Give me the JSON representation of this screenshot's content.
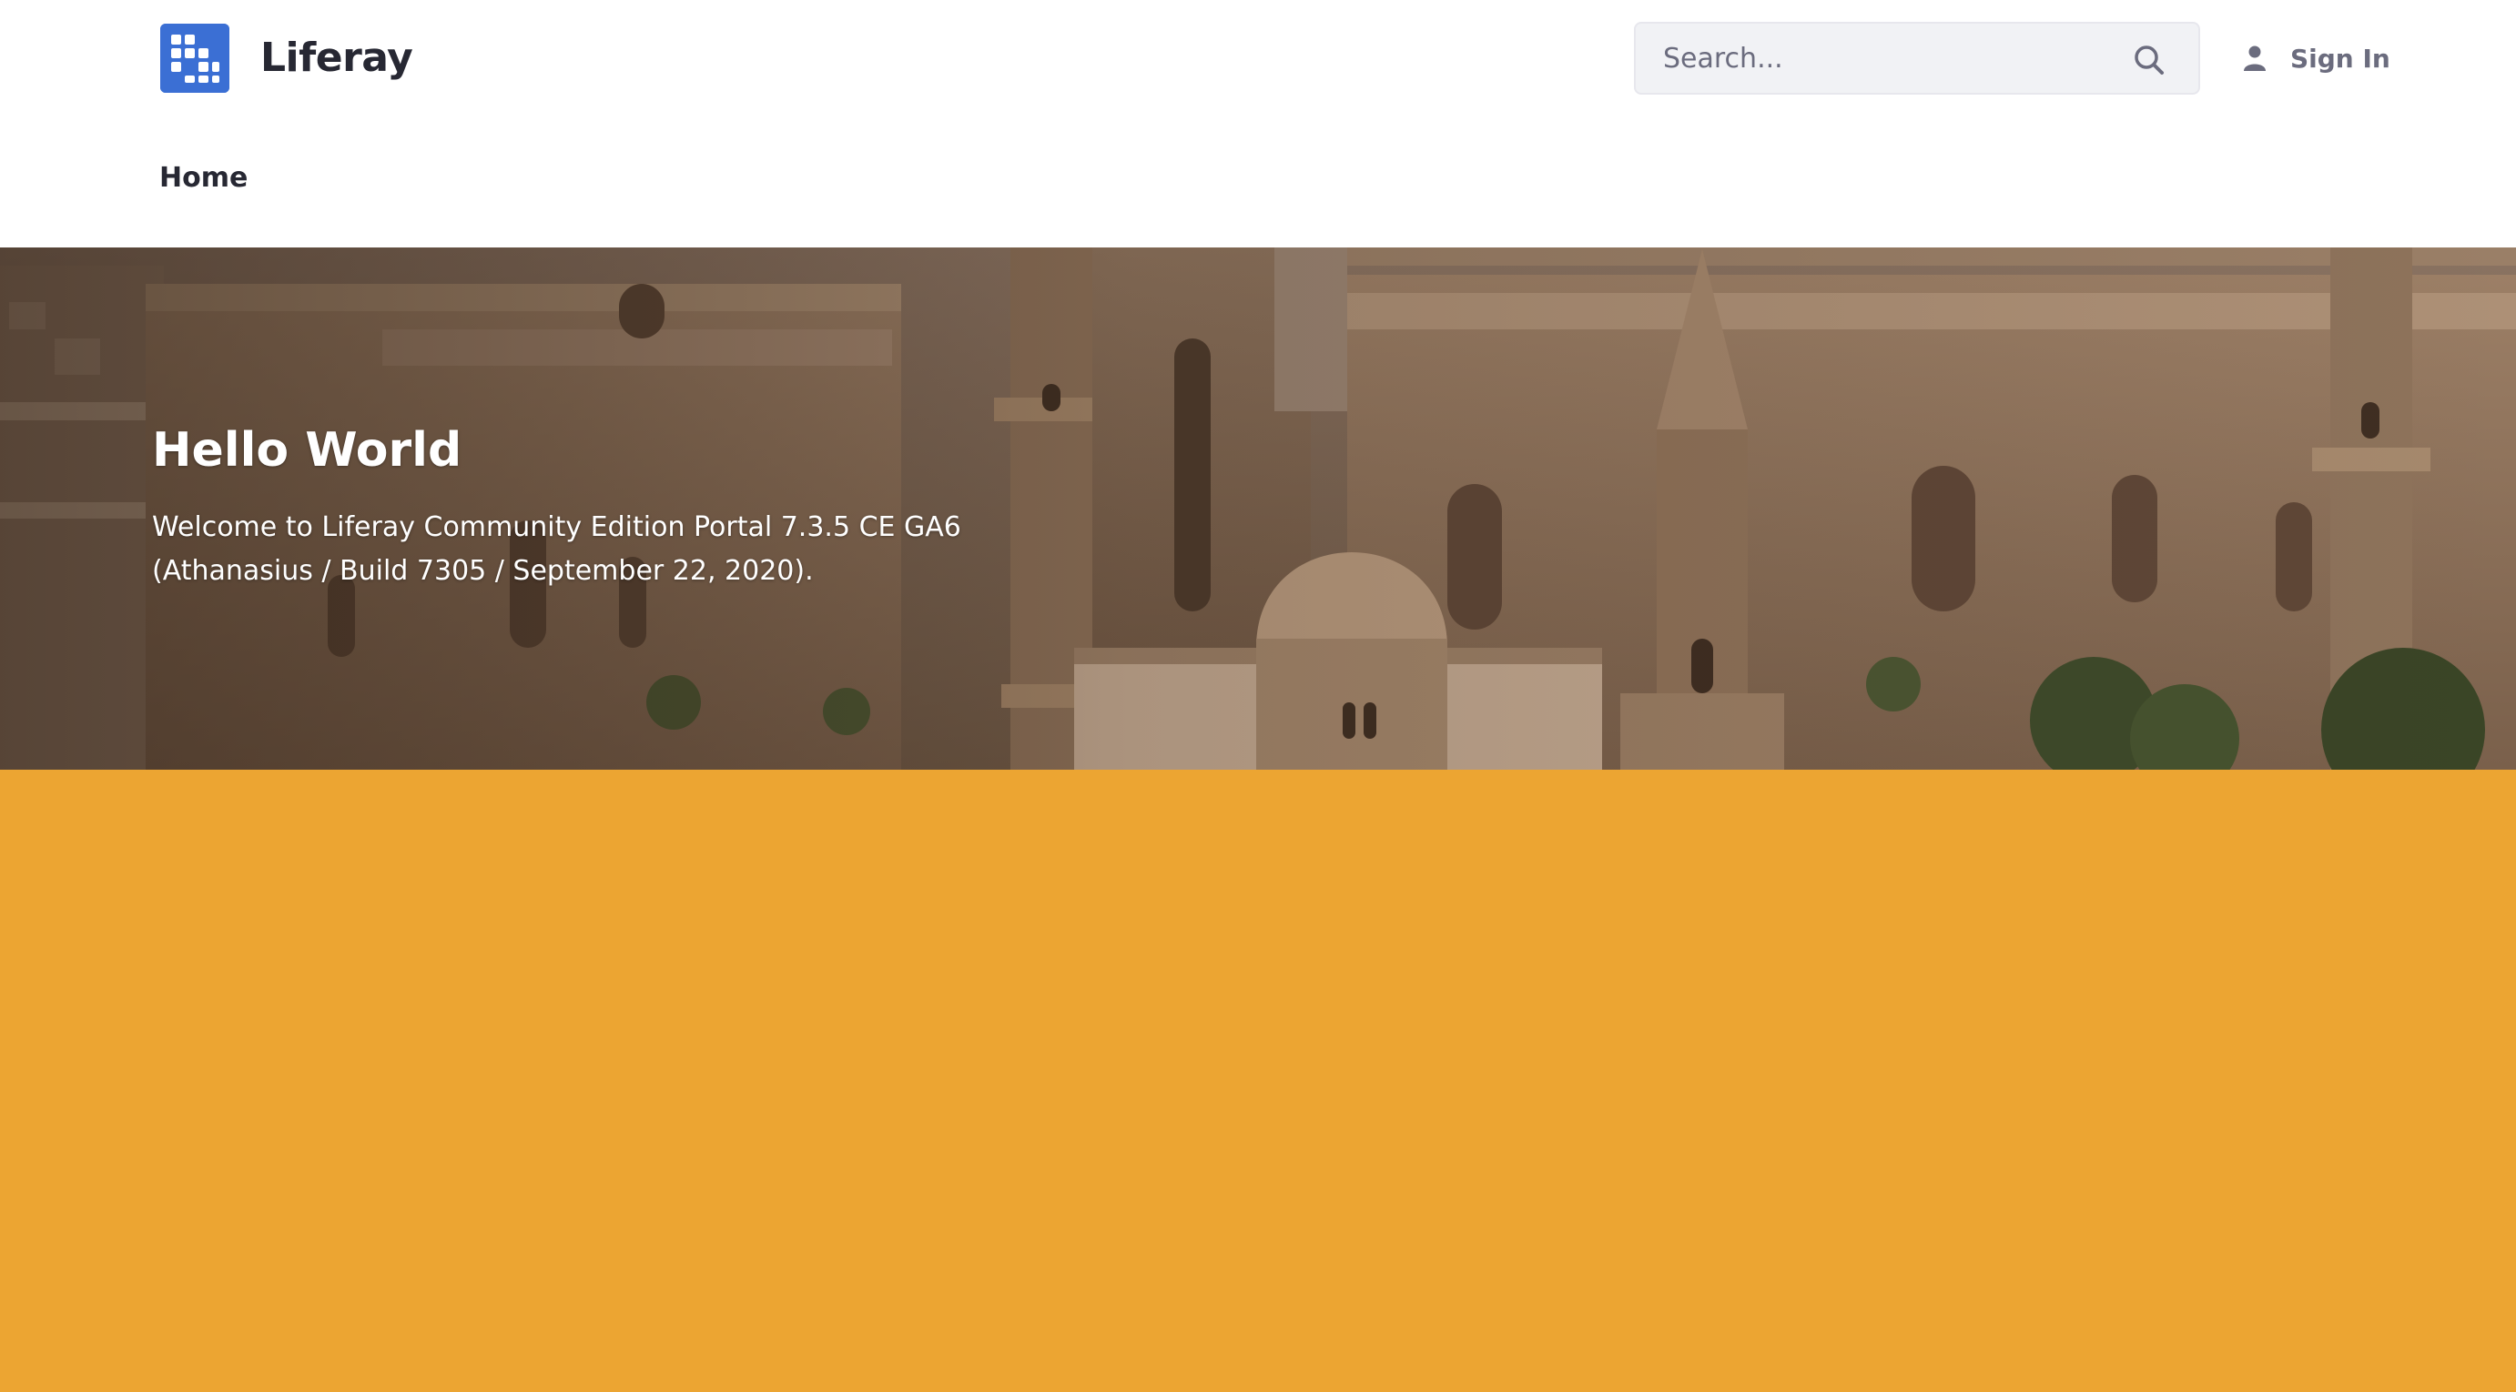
{
  "header": {
    "site_name": "Liferay",
    "logo_icon": "liferay-logo-icon",
    "search": {
      "placeholder": "Search...",
      "value": "",
      "icon": "search-icon"
    },
    "sign_in_label": "Sign In",
    "user_icon": "user-icon"
  },
  "nav": {
    "items": [
      {
        "label": "Home"
      }
    ]
  },
  "hero": {
    "title": "Hello World",
    "text": "Welcome to Liferay Community Edition Portal 7.3.5 CE GA6 (Athanasius / Build 7305 / September 22, 2020)."
  },
  "colors": {
    "brand_blue": "#3b6fd4",
    "content_background": "#eca532",
    "text_dark": "#272833",
    "text_muted": "#6b6c7e"
  }
}
